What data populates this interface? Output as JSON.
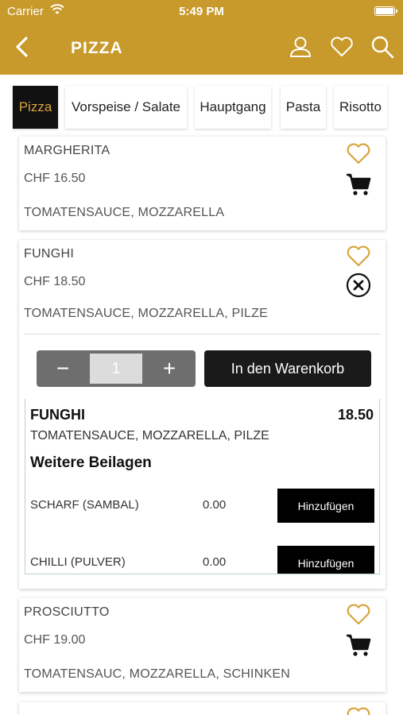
{
  "status_bar": {
    "carrier": "Carrier",
    "time": "5:49 PM"
  },
  "header": {
    "title": "PIZZA",
    "icons": [
      "back-chevron-icon",
      "user-icon",
      "heart-icon",
      "search-icon"
    ]
  },
  "tabs": [
    {
      "label": "Pizza",
      "active": true
    },
    {
      "label": "Vorspeise / Salate",
      "active": false
    },
    {
      "label": "Hauptgang",
      "active": false
    },
    {
      "label": "Pasta",
      "active": false
    },
    {
      "label": "Risotto",
      "active": false
    }
  ],
  "products": [
    {
      "name": "MARGHERITA",
      "price": "CHF 16.50",
      "description": "TOMATENSAUCE, MOZZARELLA"
    },
    {
      "name": "FUNGHI",
      "price": "CHF 18.50",
      "description": "TOMATENSAUCE, MOZZARELLA, PILZE"
    },
    {
      "name": "PROSCIUTTO",
      "price": "CHF 19.00",
      "description": "TOMATENSAUC, MOZZARELLA, SCHINKEN"
    }
  ],
  "expanded": {
    "quantity": "1",
    "minus_label": "−",
    "plus_label": "+",
    "add_to_cart_label": "In den Warenkorb",
    "detail_name": "FUNGHI",
    "detail_price": "18.50",
    "detail_description": "TOMATENSAUCE, MOZZARELLA, PILZE",
    "extras_title": "Weitere Beilagen",
    "addons": [
      {
        "name": "SCHARF (SAMBAL)",
        "price": "0.00",
        "button": "Hinzufügen"
      },
      {
        "name": "CHILLI (PULVER)",
        "price": "0.00",
        "button": "Hinzufügen"
      }
    ]
  },
  "colors": {
    "header": "#c8992b",
    "accent_gold": "#d8a43c",
    "dark_button": "#1a1a1a"
  }
}
